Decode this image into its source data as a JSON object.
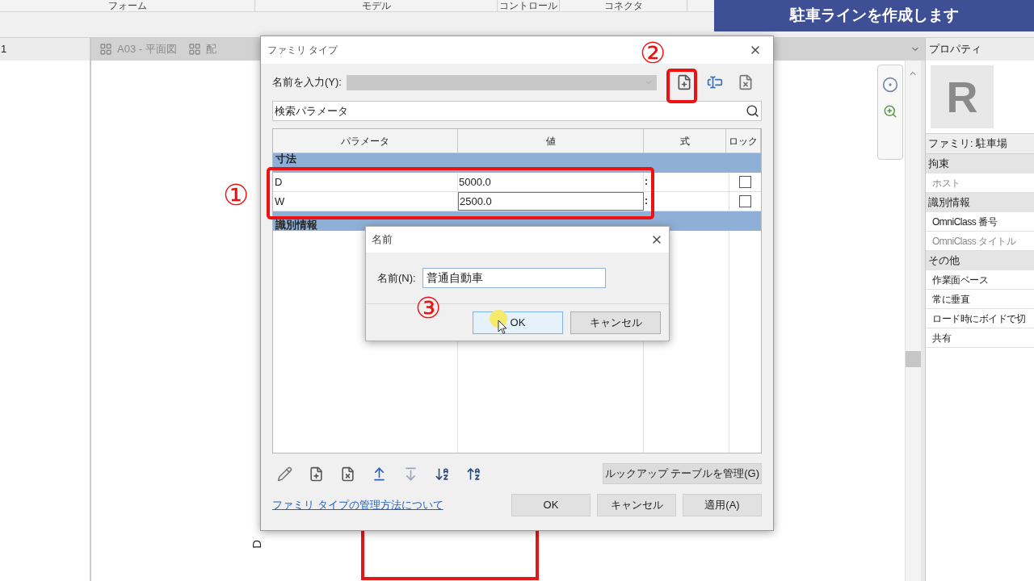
{
  "ribbon_panels": [
    "フォーム",
    "モデル",
    "コントロール",
    "コネクタ"
  ],
  "banner": "駐車ラインを作成します",
  "project_browser": {
    "label": "1"
  },
  "view_tabs": [
    {
      "label": "A03 - 平面図",
      "selected": false
    },
    {
      "label": "配",
      "selected": false
    }
  ],
  "canvas": {
    "dimension_label": "D"
  },
  "properties": {
    "title": "プロパティ",
    "thumbnail_letter": "R",
    "family": "ファミリ: 駐車場",
    "groups": [
      {
        "name": "拘束",
        "items": [
          {
            "label": "ホスト",
            "disabled": true
          }
        ]
      },
      {
        "name": "識別情報",
        "items": [
          {
            "label": "OmniClass 番号",
            "disabled": false
          },
          {
            "label": "OmniClass タイトル",
            "disabled": true
          }
        ]
      },
      {
        "name": "その他",
        "items": [
          {
            "label": "作業面ベース",
            "disabled": false
          },
          {
            "label": "常に垂直",
            "disabled": false
          },
          {
            "label": "ロード時にボイドで切",
            "disabled": false
          },
          {
            "label": "共有",
            "disabled": false
          }
        ]
      }
    ]
  },
  "family_types_dialog": {
    "title": "ファミリ タイプ",
    "name_label": "名前を入力(Y):",
    "name_combo": {
      "disabled": true
    },
    "search": {
      "value": "検索パラメータ"
    },
    "columns": [
      "パラメータ",
      "値",
      "式",
      "ロック"
    ],
    "groups": [
      {
        "name": "寸法",
        "rows": [
          {
            "parameter": "D",
            "value": "5000.0",
            "locked": false,
            "selected": false
          },
          {
            "parameter": "W",
            "value": "2500.0",
            "locked": false,
            "selected": true
          }
        ]
      },
      {
        "name": "識別情報"
      }
    ],
    "lookup_button": "ルックアップ テーブルを管理(G)",
    "help_link": "ファミリ タイプの管理方法について",
    "buttons": [
      "OK",
      "キャンセル",
      "適用(A)"
    ]
  },
  "name_dialog": {
    "title": "名前",
    "field_label": "名前(N):",
    "value": "普通自動車",
    "buttons": [
      {
        "label": "OK",
        "focused": true
      },
      {
        "label": "キャンセル",
        "focused": false
      }
    ]
  },
  "annotations": [
    "①",
    "②",
    "③"
  ]
}
